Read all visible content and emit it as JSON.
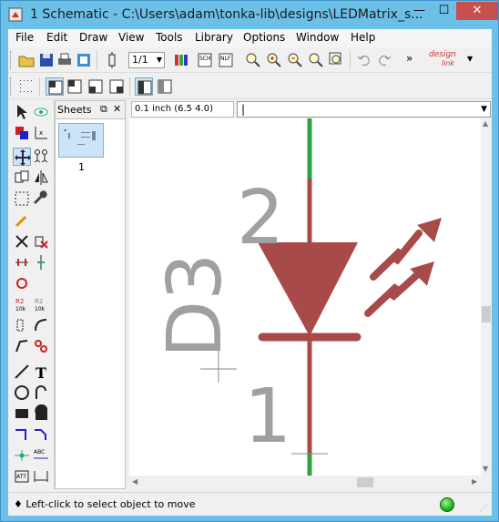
{
  "window": {
    "title": "1 Schematic - C:\\Users\\adam\\tonka-lib\\designs\\LEDMatrix_s...",
    "minimize": "—",
    "maximize": "☐",
    "close": "✕"
  },
  "menu": [
    "File",
    "Edit",
    "Draw",
    "View",
    "Tools",
    "Library",
    "Options",
    "Window",
    "Help"
  ],
  "toolbar": {
    "page_select": "1/1",
    "overflow": "»",
    "logo_top": "design",
    "logo_bottom": "link"
  },
  "sheets_panel": {
    "title": "Sheets",
    "sheet_number": "1"
  },
  "coord_readout": "0.1 inch (6.5 4.0)",
  "command_input": {
    "value": ""
  },
  "schematic": {
    "ref_designator": "D3",
    "pin_top": "2",
    "pin_bottom": "1",
    "component": "LED"
  },
  "colors": {
    "component": "#a94a4a",
    "wire": "#2ea043",
    "pin_text": "#a0a0a0"
  },
  "status": {
    "text": "♦ Left-click to select object to move"
  }
}
